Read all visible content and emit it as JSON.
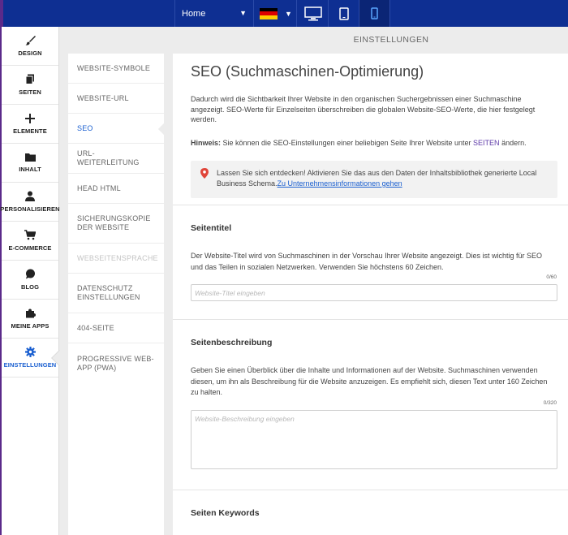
{
  "topbar": {
    "page_select": "Home",
    "language_flag_colors": [
      "#000000",
      "#dd0000",
      "#ffce00"
    ],
    "devices": [
      "desktop-icon",
      "tablet-icon",
      "mobile-icon"
    ],
    "active_device": "mobile-icon",
    "bg_color": "#0e2f92"
  },
  "sidebar": {
    "items": [
      {
        "label": "DESIGN",
        "icon": "brush-icon"
      },
      {
        "label": "SEITEN",
        "icon": "pages-icon"
      },
      {
        "label": "ELEMENTE",
        "icon": "plus-icon"
      },
      {
        "label": "INHALT",
        "icon": "folder-icon"
      },
      {
        "label": "PERSONALISIEREN",
        "icon": "person-icon"
      },
      {
        "label": "E-COMMERCE",
        "icon": "cart-icon"
      },
      {
        "label": "BLOG",
        "icon": "chat-bubble-icon"
      },
      {
        "label": "MEINE APPS",
        "icon": "puzzle-icon"
      },
      {
        "label": "EINSTELLUNGEN",
        "icon": "gear-icon"
      }
    ],
    "active": "EINSTELLUNGEN",
    "accent_color": "#1a5fd0"
  },
  "header": {
    "title": "EINSTELLUNGEN"
  },
  "submenu": {
    "items": [
      {
        "label": "WEBSITE-SYMBOLE"
      },
      {
        "label": "WEBSITE-URL"
      },
      {
        "label": "SEO"
      },
      {
        "label": "URL-WEITERLEITUNG"
      },
      {
        "label": "HEAD HTML"
      },
      {
        "label": "SICHERUNGSKOPIE DER WEBSITE"
      },
      {
        "label": "WEBSEITENSPRACHE"
      },
      {
        "label": "DATENSCHUTZ EINSTELLUNGEN"
      },
      {
        "label": "404-SEITE"
      },
      {
        "label": "PROGRESSIVE WEB-APP (PWA)"
      }
    ],
    "active": "SEO",
    "disabled": "WEBSEITENSPRACHE"
  },
  "main": {
    "title": "SEO (Suchmaschinen-Optimierung)",
    "intro": "Dadurch wird die Sichtbarkeit Ihrer Website in den organischen Suchergebnissen einer Suchmaschine angezeigt. SEO-Werte für Einzelseiten überschreiben die globalen Website-SEO-Werte, die hier festgelegt werden.",
    "hint_label": "Hinweis:",
    "hint_text": " Sie können die SEO-Einstellungen einer beliebigen Seite Ihrer Website unter ",
    "hint_link": "SEITEN",
    "hint_end": " ändern.",
    "info_text": "Lassen Sie sich entdecken! Aktivieren Sie das aus den Daten der Inhaltsbibliothek generierte Local Business Schema.",
    "info_link": "Zu Unternehmensinformationen gehen",
    "sections": {
      "title": {
        "heading": "Seitentitel",
        "desc": "Der Website-Titel wird von Suchmaschinen in der Vorschau Ihrer Website angezeigt. Dies ist wichtig für SEO und das Teilen in sozialen Netzwerken. Verwenden Sie höchstens 60 Zeichen.",
        "counter": "0/60",
        "placeholder": "Website-Titel eingeben",
        "value": ""
      },
      "description": {
        "heading": "Seitenbeschreibung",
        "desc": "Geben Sie einen Überblick über die Inhalte und Informationen auf der Website. Suchmaschinen verwenden diesen, um ihn als Beschreibung für die Website anzuzeigen. Es empfiehlt sich, diesen Text unter 160 Zeichen zu halten.",
        "counter": "0/320",
        "placeholder": "Website-Beschreibung eingeben",
        "value": ""
      },
      "keywords": {
        "heading": "Seiten Keywords"
      }
    }
  }
}
